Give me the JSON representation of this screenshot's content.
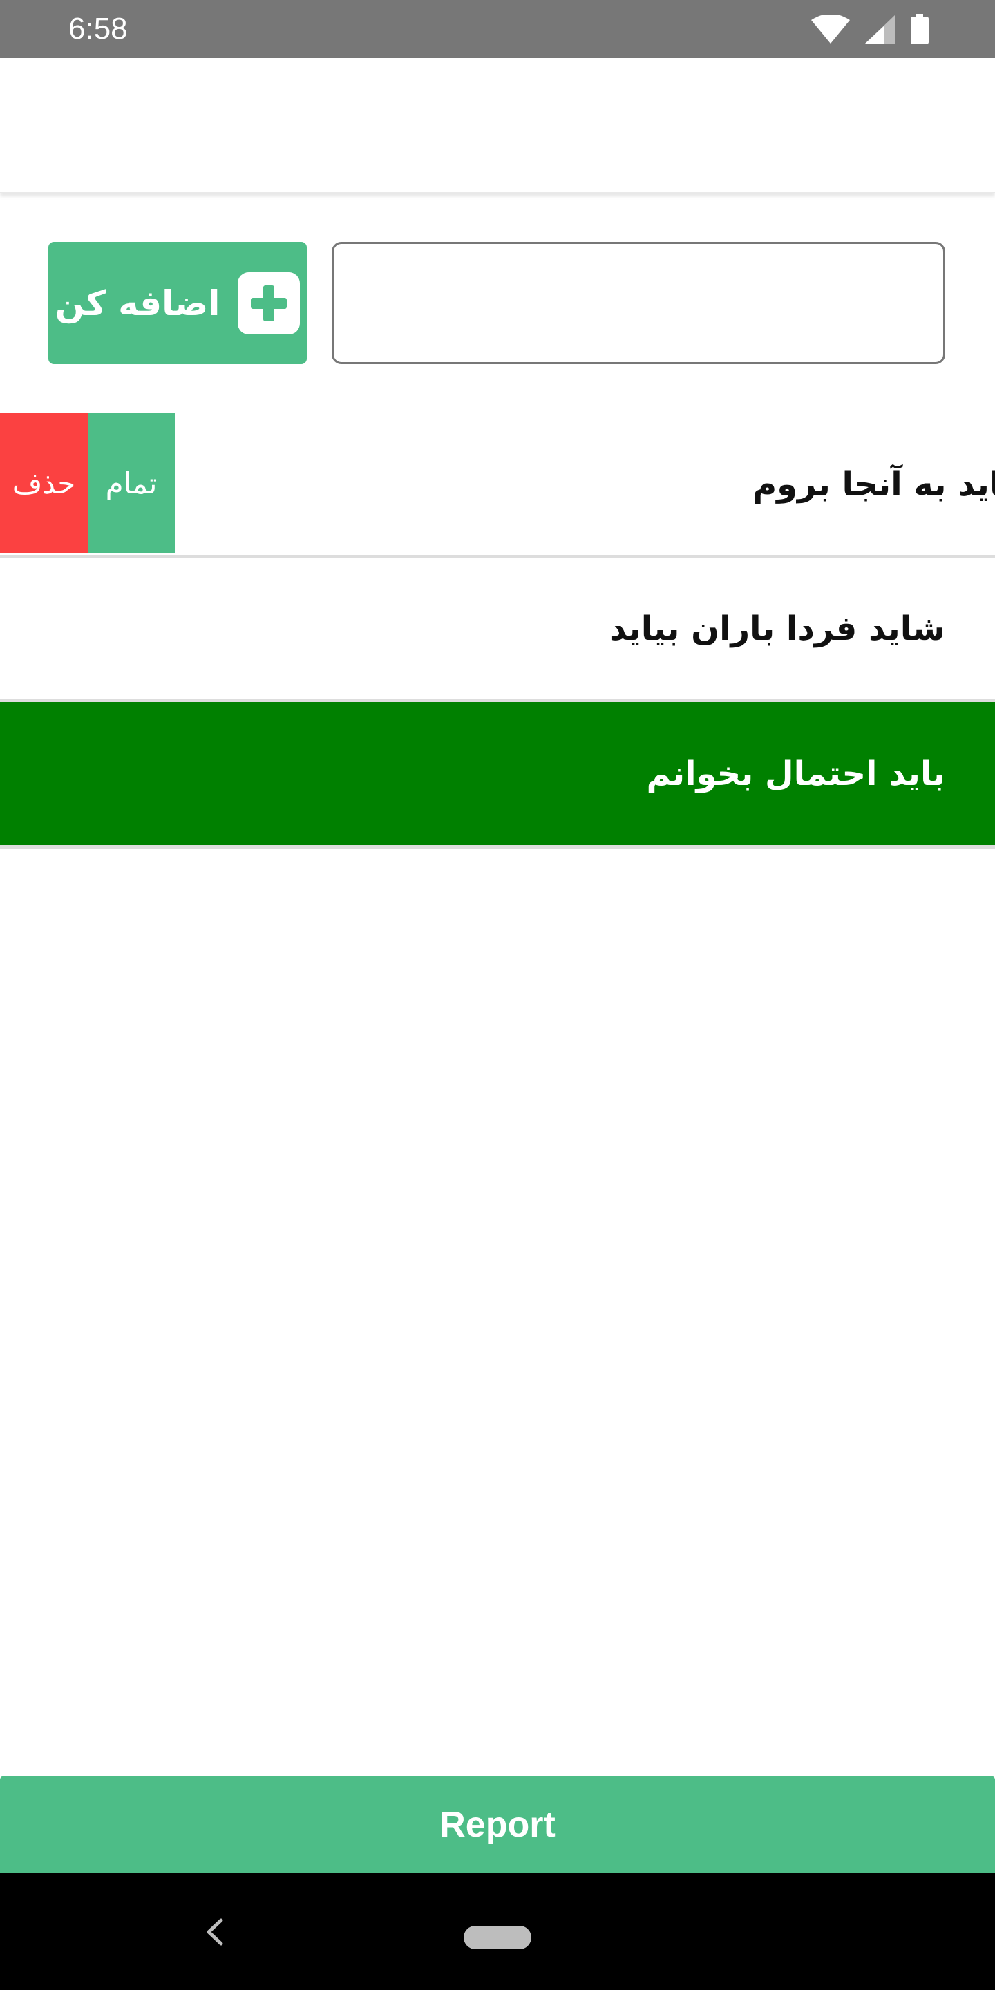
{
  "status_bar": {
    "time": "6:58",
    "icons": [
      "wifi-icon",
      "cell-signal-icon",
      "battery-icon"
    ]
  },
  "input": {
    "value": "",
    "placeholder": ""
  },
  "add_button": {
    "label": "اضافه کن",
    "icon": "plus-icon"
  },
  "todos": [
    {
      "text": "باید به آنجا بروم",
      "state": "swiped-open"
    },
    {
      "text": "شاید فردا باران بیاید",
      "state": "normal"
    },
    {
      "text": "باید احتمال بخوانم",
      "state": "done"
    }
  ],
  "swipe_actions": {
    "delete": "حذف",
    "done": "تمام"
  },
  "report_button": {
    "label": "Report"
  },
  "colors": {
    "status_bar": "#777777",
    "accent_green": "#4dbd87",
    "done_row": "#008000",
    "delete_red": "#fb4141",
    "nav_bar": "#000000"
  }
}
